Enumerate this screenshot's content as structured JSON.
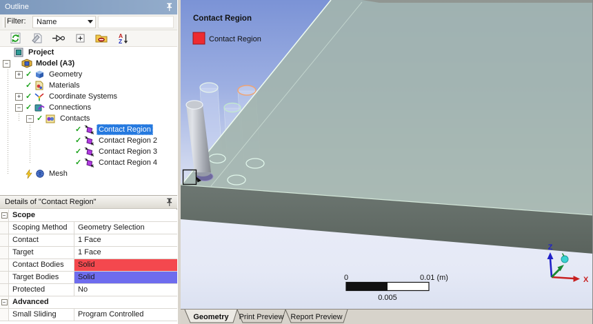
{
  "colors": {
    "selection": "#2579df",
    "check_green": "#1ca31c",
    "contact_red": "#f4484e",
    "target_violet": "#6e6cee",
    "legend_red": "#ee2b30",
    "titlebar_blue": "#7c98bc"
  },
  "outline": {
    "title": "Outline",
    "filter_label": "Filter:",
    "filter_value": "Name",
    "toolbar": [
      "refresh-icon",
      "worksheet-icon",
      "go-to-icon",
      "expand-all-icon",
      "collapse-folder-icon",
      "sort-az-icon"
    ],
    "tree": [
      {
        "label": "Project",
        "level": 0,
        "icon": "project-icon",
        "bold": true
      },
      {
        "label": "Model (A3)",
        "level": 1,
        "expander": "minus",
        "icon": "model-icon",
        "bold": true
      },
      {
        "label": "Geometry",
        "level": 2,
        "expander": "plus",
        "check": true,
        "icon": "geometry-icon"
      },
      {
        "label": "Materials",
        "level": 2,
        "check": true,
        "icon": "materials-icon"
      },
      {
        "label": "Coordinate Systems",
        "level": 2,
        "expander": "plus",
        "check": true,
        "icon": "coordinate-systems-icon"
      },
      {
        "label": "Connections",
        "level": 2,
        "expander": "minus",
        "check": true,
        "icon": "connections-icon"
      },
      {
        "label": "Contacts",
        "level": 3,
        "expander": "minus",
        "check": true,
        "icon": "contacts-icon"
      },
      {
        "label": "Contact Region",
        "level": 4,
        "check": true,
        "icon": "contact-region-icon",
        "selected": true
      },
      {
        "label": "Contact Region 2",
        "level": 4,
        "check": true,
        "icon": "contact-region-icon"
      },
      {
        "label": "Contact Region 3",
        "level": 4,
        "check": true,
        "icon": "contact-region-icon"
      },
      {
        "label": "Contact Region 4",
        "level": 4,
        "check": true,
        "icon": "contact-region-icon"
      },
      {
        "label": "Mesh",
        "level": 2,
        "bolt": true,
        "icon": "mesh-icon"
      }
    ]
  },
  "details": {
    "title": "Details of \"Contact Region\"",
    "rows": [
      {
        "type": "group",
        "label": "Scope"
      },
      {
        "type": "row",
        "label": "Scoping Method",
        "value": "Geometry Selection"
      },
      {
        "type": "row",
        "label": "Contact",
        "value": "1 Face"
      },
      {
        "type": "row",
        "label": "Target",
        "value": "1 Face"
      },
      {
        "type": "row",
        "label": "Contact Bodies",
        "value": "Solid",
        "value_color": "contact_red"
      },
      {
        "type": "row",
        "label": "Target Bodies",
        "value": "Solid",
        "value_color": "target_violet"
      },
      {
        "type": "row",
        "label": "Protected",
        "value": "No"
      },
      {
        "type": "group",
        "label": "Advanced"
      },
      {
        "type": "row",
        "label": "Small Sliding",
        "value": "Program Controlled"
      }
    ]
  },
  "viewport": {
    "annotation_title": "Contact Region",
    "legend": [
      {
        "swatch": "#ee2b30",
        "label": "Contact Region"
      }
    ],
    "scale_bar": {
      "left": "0",
      "right": "0.01 (m)",
      "mid": "0.005"
    },
    "triad": {
      "z": "Z",
      "x": "X"
    },
    "tabs": [
      {
        "label": "Geometry",
        "active": true
      },
      {
        "label": "Print Preview",
        "active": false
      },
      {
        "label": "Report Preview",
        "active": false
      }
    ]
  }
}
